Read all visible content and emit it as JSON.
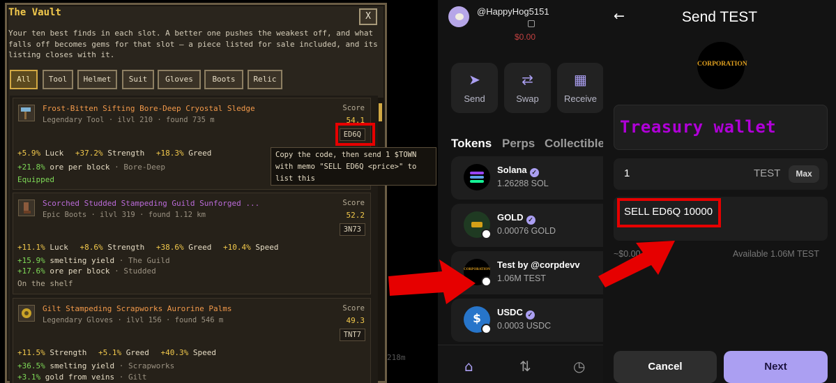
{
  "vault": {
    "title": "The Vault",
    "close_label": "X",
    "description": "Your ten best finds in each slot. A better one pushes the weakest off, and what falls off becomes gems for that slot — a piece listed for sale included, and its listing closes with it.",
    "filters": [
      "All",
      "Tool",
      "Helmet",
      "Suit",
      "Gloves",
      "Boots",
      "Relic"
    ],
    "active_filter": "All",
    "score_label": "Score",
    "items": [
      {
        "name": "Frost-Bitten Sifting Bore-Deep Cryostal Sledge",
        "rarity": "Legendary",
        "meta": "Legendary Tool · ilvl 210 · found 735 m",
        "score": "54.1",
        "code": "ED6Q",
        "stats": [
          {
            "value": "+5.9%",
            "key": "Luck"
          },
          {
            "value": "+37.2%",
            "key": "Strength"
          },
          {
            "value": "+18.3%",
            "key": "Greed"
          }
        ],
        "lines": [
          {
            "value": "+21.8%",
            "key": "ore per block",
            "source": "· Bore-Deep"
          }
        ],
        "status": "Equipped"
      },
      {
        "name": "Scorched Studded Stampeding Guild Sunforged ...",
        "rarity": "Epic",
        "meta": "Epic Boots · ilvl 319 · found 1.12 km",
        "score": "52.2",
        "code": "3N73",
        "stats": [
          {
            "value": "+11.1%",
            "key": "Luck"
          },
          {
            "value": "+8.6%",
            "key": "Strength"
          },
          {
            "value": "+38.6%",
            "key": "Greed"
          },
          {
            "value": "+10.4%",
            "key": "Speed"
          }
        ],
        "lines": [
          {
            "value": "+15.9%",
            "key": "smelting yield",
            "source": "· The Guild"
          },
          {
            "value": "+17.6%",
            "key": "ore per block",
            "source": "· Studded"
          }
        ],
        "status": "On the shelf"
      },
      {
        "name": "Gilt Stampeding Scrapworks Aurorine Palms",
        "rarity": "Legendary",
        "meta": "Legendary Gloves · ilvl 156 · found 546 m",
        "score": "49.3",
        "code": "TNT7",
        "stats": [
          {
            "value": "+11.5%",
            "key": "Strength"
          },
          {
            "value": "+5.1%",
            "key": "Greed"
          },
          {
            "value": "+40.3%",
            "key": "Speed"
          }
        ],
        "lines": [
          {
            "value": "+36.5%",
            "key": "smelting yield",
            "source": "· Scrapworks"
          },
          {
            "value": "+3.1%",
            "key": "gold from veins",
            "source": "· Gilt"
          }
        ]
      }
    ],
    "tooltip": "Copy the code, then send 1 $TOWN with memo \"SELL ED6Q <price>\" to list this",
    "background_text": "218m"
  },
  "wallet": {
    "username": "@HappyHog5151",
    "balance_peek": "$0.00",
    "actions": [
      {
        "label": "Send",
        "icon": "send-icon"
      },
      {
        "label": "Swap",
        "icon": "swap-icon"
      },
      {
        "label": "Receive",
        "icon": "qr-icon"
      }
    ],
    "tabs": [
      "Tokens",
      "Perps",
      "Collectibles"
    ],
    "tokens": [
      {
        "name": "Solana",
        "amount": "1.26288 SOL",
        "verified": true
      },
      {
        "name": "GOLD",
        "amount": "0.00076 GOLD",
        "verified": true
      },
      {
        "name": "Test by @corpdevv",
        "amount": "1.06M TEST",
        "verified": false,
        "logo_text": "CORPORATION"
      },
      {
        "name": "USDC",
        "amount": "0.0003 USDC",
        "verified": true
      }
    ],
    "nav": [
      "home-icon",
      "swap-icon",
      "history-icon"
    ]
  },
  "send": {
    "title": "Send TEST",
    "logo_text": "CORPORATION",
    "recipient": "Treasury wallet",
    "amount": "1",
    "unit": "TEST",
    "max_label": "Max",
    "memo": "SELL ED6Q 10000",
    "usd_estimate": "~$0.00",
    "available": "Available 1.06M TEST",
    "cancel_label": "Cancel",
    "next_label": "Next"
  },
  "colors": {
    "annotation_red": "#e60000",
    "vault_gold": "#f2c94c",
    "legendary_orange": "#f2994a",
    "epic_purple": "#bb6bd9",
    "wallet_accent": "#ab9ff2",
    "recipient_purple": "#b000d8"
  }
}
